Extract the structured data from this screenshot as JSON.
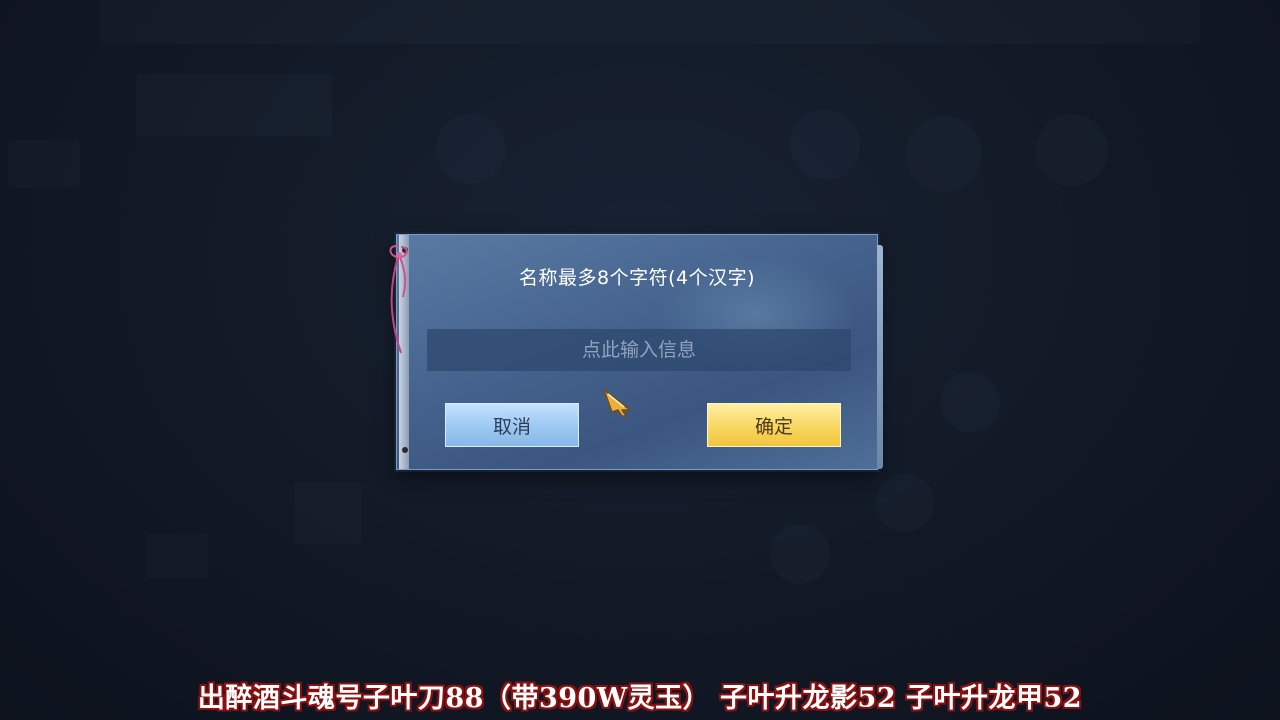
{
  "dialog": {
    "title": "名称最多8个字符(4个汉字)",
    "input": {
      "value": "",
      "placeholder": "点此输入信息"
    },
    "cancel_label": "取消",
    "confirm_label": "确定"
  },
  "caption": "出醉酒斗魂号子叶刀88（带390W灵玉） 子叶升龙影52 子叶升龙甲52",
  "colors": {
    "dialog_bg": "#43618c",
    "cancel_button": "#9cc8f2",
    "confirm_button": "#f8d660",
    "caption_outline": "#8a1010"
  },
  "icons": {
    "cursor": "arrow-cursor-icon",
    "ribbon": "ribbon-icon"
  }
}
